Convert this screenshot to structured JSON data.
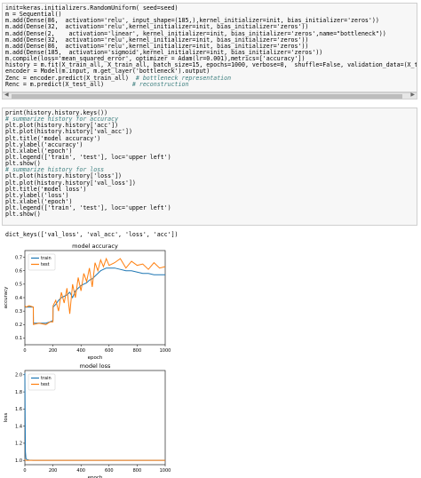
{
  "cell1": {
    "lines": [
      {
        "t": "init=keras.initializers.RandomUniform( seed=seed)"
      },
      {
        "t": "m = Sequential()"
      },
      {
        "t": "m.add(Dense(86,  activation='relu', input_shape=(185,),kernel_initializer=init, bias_initializer='zeros'))"
      },
      {
        "t": "m.add(Dense(32,  activation='relu',kernel_initializer=init, bias_initializer='zeros'))"
      },
      {
        "t": "m.add(Dense(2,    activation='linear', kernel_initializer=init, bias_initializer='zeros',name=\"bottleneck\"))"
      },
      {
        "t": "m.add(Dense(32,  activation='relu',kernel_initializer=init, bias_initializer='zeros'))"
      },
      {
        "t": "m.add(Dense(86,  activation='relu',kernel_initializer=init, bias_initializer='zeros'))"
      },
      {
        "t": "m.add(Dense(185,  activation='sigmoid',kernel_initializer=init, bias_initializer='zeros'))"
      },
      {
        "t": "m.compile(loss='mean_squared_error', optimizer = Adam(lr=0.001),metrics=['accuracy'])"
      },
      {
        "t": "history = m.fit(X_train_all, X_train_all, batch_size=15, epochs=1000, verbose=0,  shuffle=False, validation_data=(X_test_all, X_te"
      },
      {
        "t": "encoder = Model(m.input, m.get_layer('bottleneck').output)"
      },
      {
        "t": "Zenc = encoder.predict(X_train_all)  ",
        "c": "# bottleneck representation"
      },
      {
        "t": "Renc = m.predict(X_test_all)        ",
        "c": "# reconstruction"
      }
    ]
  },
  "cell2": {
    "lines": [
      {
        "t": "print(history.history.keys())"
      },
      {
        "t": "",
        "c": "# summarize history for accuracy"
      },
      {
        "t": "plt.plot(history.history['acc'])"
      },
      {
        "t": "plt.plot(history.history['val_acc'])"
      },
      {
        "t": "plt.title('model accuracy')"
      },
      {
        "t": "plt.ylabel('accuracy')"
      },
      {
        "t": "plt.xlabel('epoch')"
      },
      {
        "t": "plt.legend(['train', 'test'], loc='upper left')"
      },
      {
        "t": "plt.show()"
      },
      {
        "t": "",
        "c": "# summarize history for loss"
      },
      {
        "t": "plt.plot(history.history['loss'])"
      },
      {
        "t": "plt.plot(history.history['val_loss'])"
      },
      {
        "t": "plt.title('model loss')"
      },
      {
        "t": "plt.ylabel('loss')"
      },
      {
        "t": "plt.xlabel('epoch')"
      },
      {
        "t": "plt.legend(['train', 'test'], loc='upper left')"
      },
      {
        "t": "plt.show()"
      }
    ]
  },
  "output_keys": "dict_keys(['val_loss', 'val_acc', 'loss', 'acc'])",
  "colors": {
    "train": "#1f77b4",
    "test": "#ff7f0e"
  },
  "chart_data": [
    {
      "type": "line",
      "title": "model accuracy",
      "xlabel": "epoch",
      "ylabel": "accuracy",
      "xlim": [
        0,
        1000
      ],
      "ylim": [
        0.05,
        0.75
      ],
      "xticks": [
        0,
        200,
        400,
        600,
        800,
        1000
      ],
      "yticks": [
        0.1,
        0.2,
        0.3,
        0.4,
        0.5,
        0.6,
        0.7
      ],
      "legend": "upper left",
      "series": [
        {
          "name": "train",
          "x": [
            0,
            10,
            30,
            60,
            61,
            100,
            150,
            180,
            200,
            201,
            220,
            240,
            260,
            280,
            300,
            320,
            340,
            360,
            380,
            400,
            420,
            440,
            460,
            480,
            500,
            520,
            540,
            560,
            580,
            600,
            640,
            680,
            720,
            760,
            800,
            840,
            880,
            920,
            960,
            1000
          ],
          "values": [
            0.33,
            0.33,
            0.33,
            0.33,
            0.21,
            0.21,
            0.21,
            0.22,
            0.23,
            0.33,
            0.35,
            0.38,
            0.4,
            0.41,
            0.42,
            0.44,
            0.4,
            0.45,
            0.47,
            0.49,
            0.5,
            0.51,
            0.53,
            0.54,
            0.56,
            0.58,
            0.6,
            0.61,
            0.62,
            0.62,
            0.62,
            0.61,
            0.6,
            0.6,
            0.59,
            0.58,
            0.58,
            0.57,
            0.57,
            0.57
          ]
        },
        {
          "name": "test",
          "x": [
            0,
            10,
            30,
            60,
            61,
            100,
            150,
            180,
            200,
            201,
            220,
            240,
            260,
            280,
            300,
            320,
            340,
            360,
            380,
            400,
            420,
            440,
            460,
            480,
            500,
            520,
            540,
            560,
            580,
            600,
            640,
            680,
            720,
            760,
            800,
            840,
            880,
            920,
            960,
            1000
          ],
          "values": [
            0.34,
            0.33,
            0.34,
            0.33,
            0.2,
            0.21,
            0.2,
            0.22,
            0.22,
            0.34,
            0.38,
            0.3,
            0.44,
            0.36,
            0.47,
            0.28,
            0.5,
            0.4,
            0.55,
            0.45,
            0.58,
            0.52,
            0.62,
            0.48,
            0.66,
            0.6,
            0.68,
            0.63,
            0.69,
            0.64,
            0.66,
            0.69,
            0.62,
            0.67,
            0.64,
            0.65,
            0.61,
            0.66,
            0.62,
            0.63
          ]
        }
      ]
    },
    {
      "type": "line",
      "title": "model loss",
      "xlabel": "epoch",
      "ylabel": "loss",
      "xlim": [
        0,
        1000
      ],
      "ylim": [
        0.95,
        2.05
      ],
      "xticks": [
        0,
        200,
        400,
        600,
        800,
        1000
      ],
      "yticks": [
        1.0,
        1.2,
        1.4,
        1.6,
        1.8,
        2.0
      ],
      "legend": "upper left",
      "series": [
        {
          "name": "train",
          "x": [
            0,
            2,
            4,
            8,
            15,
            30,
            60,
            100,
            200,
            400,
            600,
            800,
            1000
          ],
          "values": [
            2.02,
            1.5,
            1.1,
            1.02,
            1.01,
            1.003,
            1.001,
            1.0,
            1.0,
            1.0,
            1.0,
            1.0,
            1.0
          ]
        },
        {
          "name": "test",
          "x": [
            0,
            2,
            4,
            8,
            15,
            30,
            60,
            100,
            200,
            400,
            600,
            800,
            1000
          ],
          "values": [
            1.01,
            1.005,
            1.002,
            1.0,
            1.0,
            1.0,
            1.0,
            1.0,
            1.0,
            1.0,
            1.0,
            1.0,
            1.0
          ]
        }
      ]
    }
  ]
}
